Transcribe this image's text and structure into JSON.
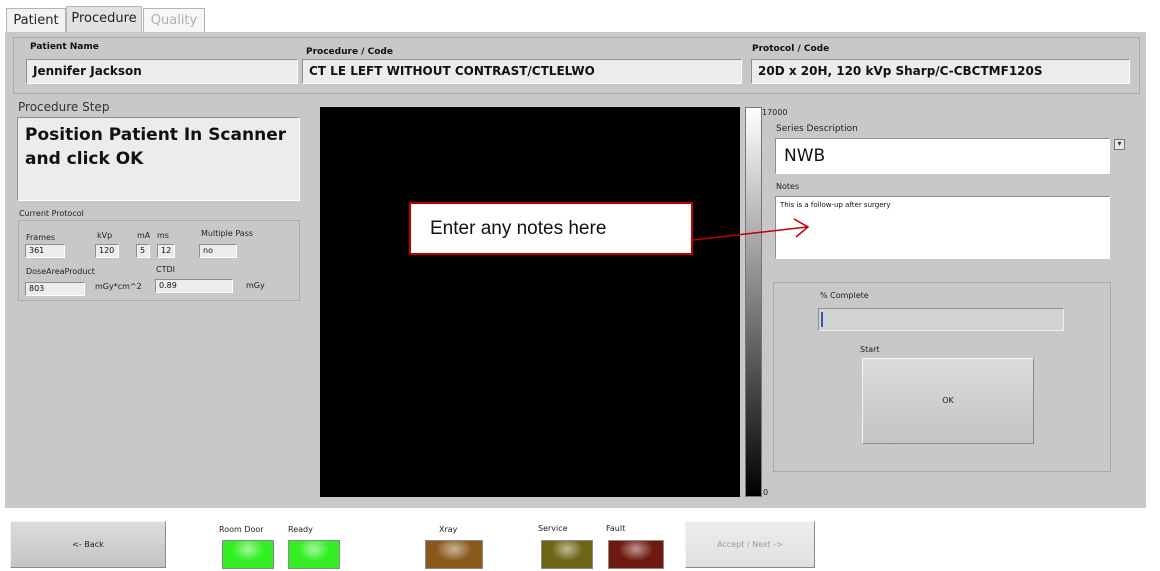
{
  "tabs": [
    {
      "label": "Patient",
      "state": "normal"
    },
    {
      "label": "Procedure",
      "state": "active"
    },
    {
      "label": "Quality",
      "state": "disabled"
    }
  ],
  "patient": {
    "label": "Patient Name",
    "value": "Jennifer Jackson"
  },
  "procedure": {
    "label": "Procedure / Code",
    "value": "CT LE LEFT WITHOUT CONTRAST/CTLELWO"
  },
  "protocol": {
    "label": "Protocol / Code",
    "value": "20D x 20H, 120 kVp Sharp/C-CBCTMF120S"
  },
  "procedure_step": {
    "title": "Procedure Step",
    "text": "Position Patient In Scanner and click OK"
  },
  "current_protocol": {
    "title": "Current Protocol",
    "frames": {
      "label": "Frames",
      "value": "361"
    },
    "kvp": {
      "label": "kVp",
      "value": "120"
    },
    "ma": {
      "label": "mA",
      "value": "5"
    },
    "ms": {
      "label": "ms",
      "value": "12"
    },
    "multiple_pass": {
      "label": "Multiple Pass",
      "value": "no"
    },
    "dap": {
      "label": "DoseAreaProduct",
      "value": "803",
      "unit": "mGy*cm^2"
    },
    "ctdi": {
      "label": "CTDI",
      "value": "0.89",
      "unit": "mGy"
    }
  },
  "scale": {
    "max": "17000",
    "min": "0"
  },
  "series": {
    "label": "Series Description",
    "value": "NWB"
  },
  "notes": {
    "label": "Notes",
    "value": "This is a follow-up after surgery"
  },
  "annotation": {
    "text": "Enter any notes here"
  },
  "progress": {
    "label": "% Complete",
    "fraction": 0.0
  },
  "start": {
    "label": "Start",
    "button": "OK"
  },
  "buttons": {
    "back": "<- Back",
    "accept": "Accept / Next ->"
  },
  "indicators": [
    {
      "label": "Room Door",
      "color": "#33ee22"
    },
    {
      "label": "Ready",
      "color": "#33ee22"
    },
    {
      "label": "Xray",
      "color": "#8a5a1c"
    },
    {
      "label": "Service",
      "color": "#6b6515"
    },
    {
      "label": "Fault",
      "color": "#6e1a10"
    }
  ],
  "colors": {
    "callout_border": "#c00000",
    "arrow": "#c00000"
  }
}
